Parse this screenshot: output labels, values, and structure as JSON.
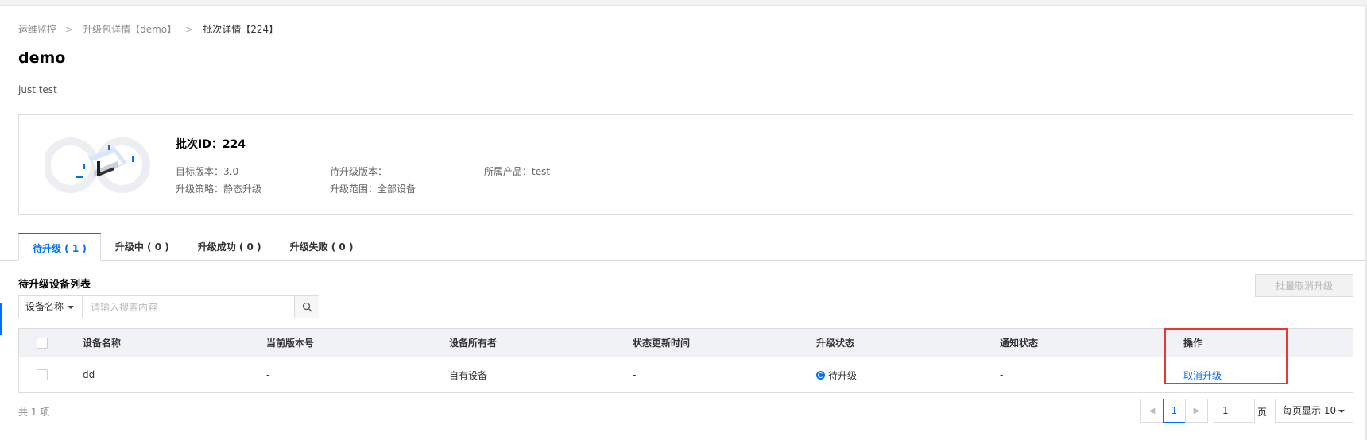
{
  "breadcrumb": {
    "level1": "运维监控",
    "level2": "升级包详情【demo】",
    "level3": "批次详情【224】",
    "separator": ">"
  },
  "page": {
    "title": "demo",
    "description": "just test"
  },
  "batch": {
    "title": "批次ID：224",
    "target_version": "目标版本：3.0",
    "pending_version": "待升级版本：-",
    "product": "所属产品：test",
    "strategy": "升级策略：静态升级",
    "scope": "升级范围：全部设备"
  },
  "tabs": [
    {
      "label": "待升级 ( 1 )"
    },
    {
      "label": "升级中 ( 0 )"
    },
    {
      "label": "升级成功 ( 0 )"
    },
    {
      "label": "升级失败 ( 0 )"
    }
  ],
  "list": {
    "title": "待升级设备列表",
    "batch_cancel_label": "批量取消升级",
    "search_field": "设备名称",
    "search_placeholder": "请输入搜索内容"
  },
  "table": {
    "headers": [
      "设备名称",
      "当前版本号",
      "设备所有者",
      "状态更新时间",
      "升级状态",
      "通知状态",
      "操作"
    ],
    "rows": [
      {
        "name": "dd",
        "version": "-",
        "owner": "自有设备",
        "updated": "-",
        "status": "待升级",
        "notify": "-",
        "action": "取消升级"
      }
    ]
  },
  "pagination": {
    "total": "共 1 项",
    "current_page": "1",
    "page_input": "1",
    "page_unit": "页",
    "page_size": "每页显示 10",
    "prev": "◀",
    "next": "▶"
  },
  "colors": {
    "accent": "#006eff",
    "highlight": "#e53935"
  }
}
